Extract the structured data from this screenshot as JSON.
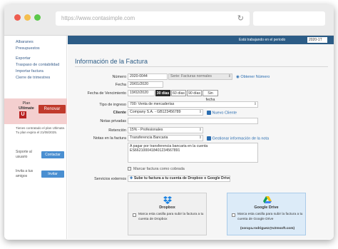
{
  "browser": {
    "url": "https://www.contasimple.com",
    "dot_colors": [
      "#ee5d50",
      "#f4be4f",
      "#5bc84a"
    ]
  },
  "sidebar": {
    "links": [
      "Albaranes",
      "Presupuestos",
      "Exportar",
      "Traspaso de contabilidad",
      "Importar factura",
      "Cierre de trimestres"
    ],
    "plan_label": "Plan",
    "plan_name": "Ultimate",
    "plan_icon_letter": "U",
    "renovar_label": "Renovar",
    "plan_note": "Tienes contratado el plan Ultimate. Tu plan expira el 21/08/2025.",
    "support_text": "Soporte al usuario",
    "contact_label": "Contactar",
    "invite_text": "Invita a tus amigos",
    "invite_label": "Invitar"
  },
  "header": {
    "period_text": "Está trabajando en el periodo",
    "period_value": "2020-1T"
  },
  "form": {
    "title": "Información de la Factura",
    "numero_label": "Número",
    "numero_value": "2020-0044",
    "serie_value": "Serie: Facturas normales",
    "obtener_link": "Obtener Número",
    "fecha_label": "Fecha",
    "fecha_value": "20/01/2020",
    "vencimiento_label": "Fecha de Vencimiento",
    "vencimiento_value": "19/02/2020",
    "venc_options": [
      "30 días",
      "60 días",
      "90 días",
      "Sin fecha"
    ],
    "tipo_label": "Tipo de ingreso",
    "tipo_value": "700: Venta de mercaderías",
    "cliente_label": "Cliente",
    "cliente_value": "Company S.A. - GB123456789",
    "nuevo_cliente_link": "Nuevo Cliente",
    "notas_privadas_label": "Notas privadas",
    "retencion_label": "Retención",
    "retencion_value": "15% - Profesionales",
    "notas_factura_label": "Notas en la factura",
    "notas_factura_value": "Transferencia Bancaria",
    "gestionar_link": "Gestionar información de la nota",
    "notas_text": "A pagar por transferencia bancaria en la cuenta ES6621000418401234567891",
    "cobrada_label": "Marcar factura como cobrada",
    "servicios_label": "Servicios externos",
    "servicios_text": "Sube tu factura a tu cuenta de Dropbox o Google Drive"
  },
  "cards": {
    "dropbox_title": "Dropbox",
    "dropbox_text": "Marca esta casilla para subir la factura a tu cuenta de Dropbox",
    "gdrive_title": "Google Drive",
    "gdrive_text": "Marca esta casilla para subir la factura a tu cuenta de Google Drive",
    "gdrive_email": "(soraya.rodriguez@v2msoft.com)"
  },
  "colors": {
    "brand_blue": "#2c5c86",
    "link_blue": "#2a6db0",
    "renovar_red": "#c0392b",
    "card_blue_bg": "#dcebf8",
    "card_grey_bg": "#f0f0f0"
  }
}
